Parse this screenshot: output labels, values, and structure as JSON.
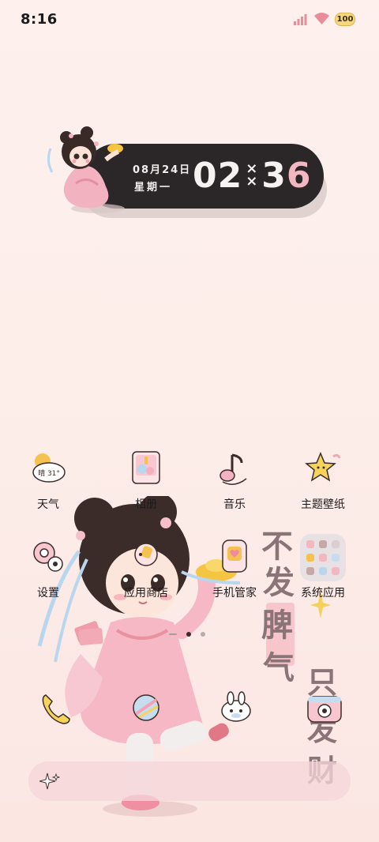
{
  "status_bar": {
    "time": "8:16",
    "battery_level": "100",
    "signal_icon": "signal-bars-icon",
    "wifi_icon": "wifi-icon"
  },
  "clock_widget": {
    "date": "08月24日",
    "weekday": "星期一",
    "hour": "02",
    "minute_first": "3",
    "minute_second": "6",
    "hour_colors": [
      "#f6f2f2",
      "#f3b7c2"
    ],
    "minute_colors": [
      "#f6f2f2",
      "#f3b7c2"
    ]
  },
  "apps_row1": [
    {
      "label": "天气",
      "icon": "weather-icon",
      "weather_text": "晴 31°"
    },
    {
      "label": "相册",
      "icon": "gallery-icon"
    },
    {
      "label": "音乐",
      "icon": "music-icon"
    },
    {
      "label": "主题壁纸",
      "icon": "theme-wallpaper-icon"
    }
  ],
  "apps_row2": [
    {
      "label": "设置",
      "icon": "settings-icon"
    },
    {
      "label": "应用商店",
      "icon": "app-store-icon"
    },
    {
      "label": "手机管家",
      "icon": "phone-manager-icon"
    },
    {
      "label": "系统应用",
      "icon": "system-apps-folder-icon"
    }
  ],
  "dock": [
    {
      "name": "phone",
      "icon": "phone-icon"
    },
    {
      "name": "browser",
      "icon": "browser-icon"
    },
    {
      "name": "messages",
      "icon": "messages-icon"
    },
    {
      "name": "camera",
      "icon": "camera-icon"
    }
  ],
  "page_indicator": {
    "pages": 3,
    "active": 1
  },
  "calligraphy_text": [
    "不",
    "发",
    "脾",
    "气",
    "只",
    "发",
    "财"
  ],
  "search_bar": {
    "icon": "sparkle-icon"
  },
  "colors": {
    "background": "#fdf0ed",
    "clock_bar": "#2b2627",
    "accent_pink": "#f3b7c2",
    "search_bar": "#f6d6da"
  }
}
